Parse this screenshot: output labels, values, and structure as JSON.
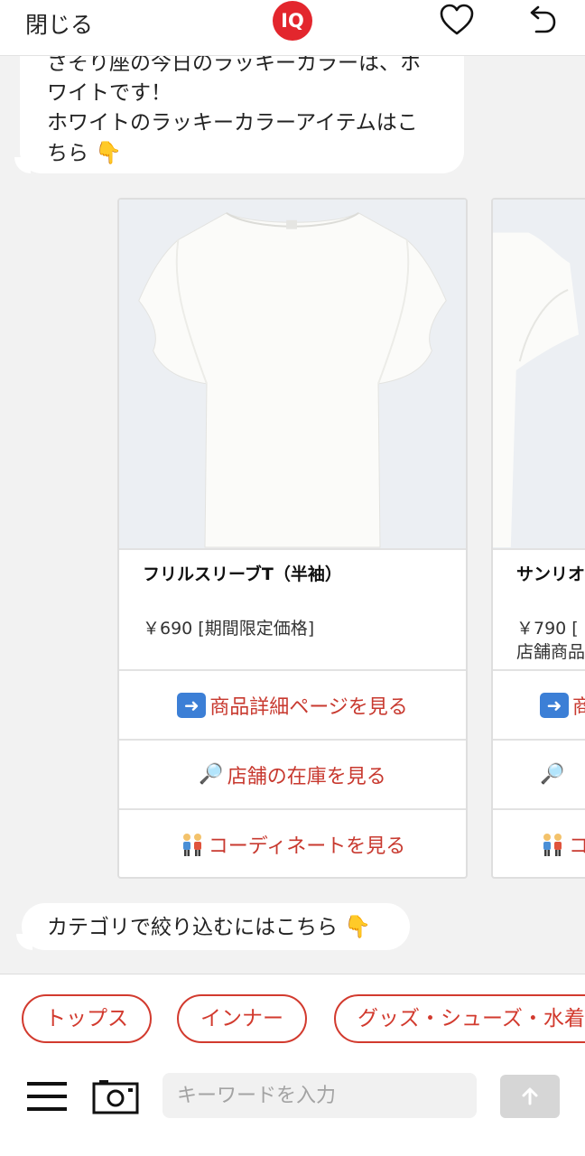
{
  "header": {
    "close_label": "閉じる",
    "logo_text": "IQ",
    "favorite_icon": "heart-icon",
    "undo_icon": "undo-icon"
  },
  "chat": {
    "message1": {
      "line1": "さそり座の今日のラッキーカラーは、ホ",
      "line2": "ワイトです！",
      "line3": "ホワイトのラッキーカラーアイテムはこ",
      "line4": "ちら",
      "emoji": "👇"
    },
    "products": [
      {
        "name": "フリルスリーブT（半袖）",
        "price": "￥690 [期間限定価格]",
        "sub": "",
        "buttons": [
          {
            "icon": "➡️",
            "label": "商品詳細ページを見る"
          },
          {
            "icon": "🔎",
            "label": "店舗の在庫を見る"
          },
          {
            "icon": "👫",
            "label": "コーディネートを見る"
          }
        ]
      },
      {
        "name": "サンリオ",
        "price": "￥790 [",
        "sub": "店舗商品",
        "buttons": [
          {
            "icon": "➡️",
            "label": "商"
          },
          {
            "icon": "🔎",
            "label": ""
          },
          {
            "icon": "👫",
            "label": "コ"
          }
        ]
      }
    ],
    "message2": {
      "text": "カテゴリで絞り込むにはこちら",
      "emoji": "👇"
    }
  },
  "chips": [
    "トップス",
    "インナー",
    "グッズ・シューズ・水着"
  ],
  "bottom": {
    "search_placeholder": "キーワードを入力",
    "menu_icon": "hamburger-menu-icon",
    "camera_icon": "camera-icon",
    "send_icon": "arrow-up-icon"
  },
  "colors": {
    "accent": "#d23a2e",
    "logo": "#e3262d",
    "background": "#f2f2f2"
  }
}
